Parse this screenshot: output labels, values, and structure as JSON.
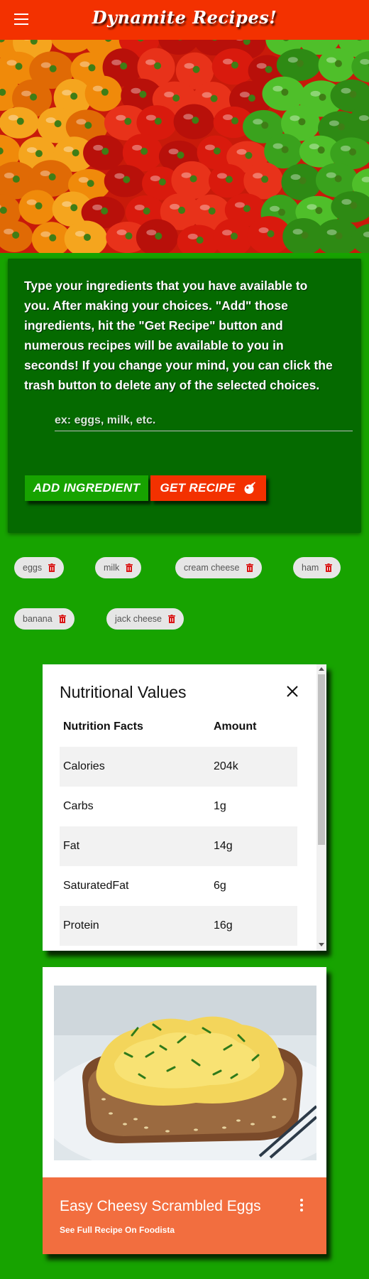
{
  "header": {
    "title": "Dynamite Recipes!",
    "menu_icon": "hamburger-menu-icon"
  },
  "hero": {
    "alt": ""
  },
  "search": {
    "instructions": "Type your ingredients that you have available to you. After making your choices. \"Add\" those ingredients, hit the \"Get Recipe\" button and numerous recipes will be available to you in seconds! If you change your mind, you can click the trash button to delete any of the selected choices.",
    "placeholder": "ex: eggs, milk, etc.",
    "add_label": "ADD INGREDIENT",
    "get_label": "GET RECIPE"
  },
  "chips": [
    {
      "label": "eggs"
    },
    {
      "label": "milk"
    },
    {
      "label": "cream cheese"
    },
    {
      "label": "ham"
    },
    {
      "label": "banana"
    },
    {
      "label": "jack cheese"
    }
  ],
  "nutrition": {
    "title": "Nutritional Values",
    "columns": [
      "Nutrition Facts",
      "Amount"
    ],
    "rows": [
      {
        "name": "Calories",
        "amount": "204k"
      },
      {
        "name": "Carbs",
        "amount": "1g"
      },
      {
        "name": "Fat",
        "amount": "14g"
      },
      {
        "name": "SaturatedFat",
        "amount": "6g"
      },
      {
        "name": "Protein",
        "amount": "16g"
      }
    ]
  },
  "recipe": {
    "title": "Easy Cheesy Scrambled Eggs",
    "link": "See Full Recipe On Foodista"
  },
  "colors": {
    "header": "#f33100",
    "background": "#17a300",
    "panel": "#056a00",
    "card_footer": "#f26e3f"
  }
}
